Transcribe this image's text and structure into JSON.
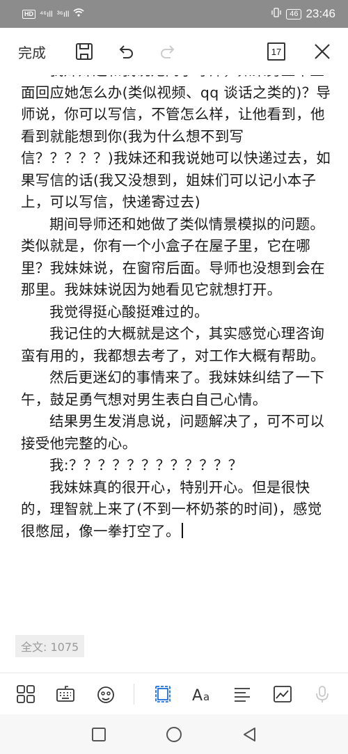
{
  "status_bar": {
    "network_label": "HD",
    "signal_1": "⁴⁶ıll",
    "signal_2": "³⁶ıll",
    "battery": "46",
    "time": "23:46"
  },
  "toolbar": {
    "done_label": "完成",
    "count_badge": "17"
  },
  "content": {
    "paragraphs": [
      "我妹妹还和我说她问了导师，如果男生不正面回应她怎么办(类似视频、qq 谈话之类的)？导师说，你可以写信，不管怎么样，让他看到，他看到就能想到你(我为什么想不到写信？？？？？)我妹还和我说她可以快递过去，如果写信的话(我又没想到，姐妹们可以记小本子上，可以写信，快递寄过去)",
      "期间导师还和她做了类似情景模拟的问题。类似就是，你有一个小盒子在屋子里，它在哪里？我妹妹说，在窗帘后面。导师也没想到会在那里。我妹妹说因为她看见它就想打开。",
      "我觉得挺心酸挺难过的。",
      "我记住的大概就是这个，其实感觉心理咨询蛮有用的，我都想去考了，对工作大概有帮助。",
      "然后更迷幻的事情来了。我妹妹纠结了一下午，鼓足勇气想对男生表白自己心情。",
      "结果男生发消息说，问题解决了，可不可以接受他完整的心。",
      "我:？？？？？？？？？？？？",
      "我妹妹真的很开心，特别开心。但是很快的，理智就上来了(不到一杯奶茶的时间)，感觉很憋屈，像一拳打空了。"
    ],
    "word_count": "全文: 1075"
  },
  "colors": {
    "status_bar_bg": "#8c8c8c",
    "accent_blue": "#1e6fd9",
    "text": "#1a1a1a",
    "icon": "#333333"
  }
}
